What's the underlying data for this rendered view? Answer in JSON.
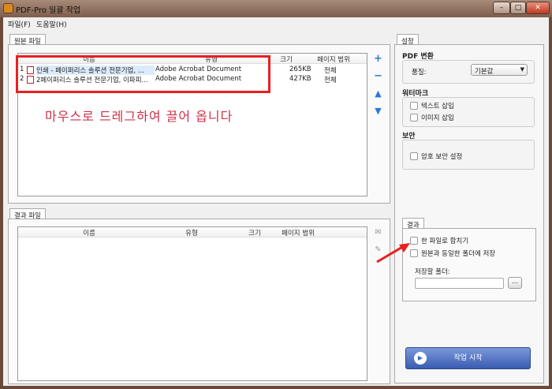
{
  "window": {
    "title": "PDF-Pro 일괄 작업",
    "controls": [
      "minimize",
      "maximize",
      "close"
    ]
  },
  "menu": [
    {
      "label": "파일(F)"
    },
    {
      "label": "도움말(H)"
    }
  ],
  "source": {
    "tab": "원본 파일",
    "columns": [
      "이름",
      "유형",
      "크기",
      "페이지 범위"
    ],
    "rows": [
      {
        "index": "1",
        "name": "인쇄 - 페이퍼리스 솔루션 전문기업, ...",
        "type": "Adobe Acrobat Document",
        "size": "265KB",
        "pages": "전체"
      },
      {
        "index": "2",
        "name": "2페이퍼리스 솔루션 전문기업, 이파피...",
        "type": "Adobe Acrobat Document",
        "size": "427KB",
        "pages": "전체"
      }
    ],
    "hint": "마우스로 드레그하여 끌어 옵니다",
    "side_icons": [
      "plus-icon",
      "minus-icon",
      "arrow-up-icon",
      "arrow-down-icon"
    ]
  },
  "result_files": {
    "tab": "결과 파일",
    "columns": [
      "이름",
      "유형",
      "크기",
      "페이지 범위"
    ]
  },
  "settings": {
    "tab": "설정",
    "pdf_title": "PDF 변환",
    "quality_label": "품질:",
    "quality_value": "기본값",
    "watermark_title": "워터마크",
    "text_insert": "텍스트 삽입",
    "image_insert": "이미지 삽입",
    "security_title": "보안",
    "password": "암호 보안 설정"
  },
  "result": {
    "tab": "결과",
    "merge": "한 파일로 합치기",
    "same_folder": "원본과 동일한 폴더에 저장",
    "folder_label": "저장할 폴더:",
    "folder_value": "",
    "browse": "..."
  },
  "start_button": "작업 시작",
  "colors": {
    "highlight": "#e82020",
    "hint_text": "#d03048",
    "start_button": "#4a6cc0"
  }
}
